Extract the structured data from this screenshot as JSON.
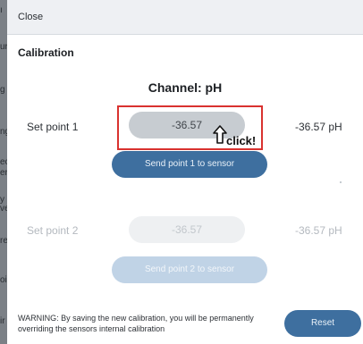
{
  "background": {
    "fragments": [
      "ı",
      "ur",
      "g",
      "ng",
      "ec",
      "er",
      "y",
      "ver",
      "re",
      "oir",
      "ir"
    ]
  },
  "header": {
    "close_label": "Close"
  },
  "calibration": {
    "title": "Calibration",
    "channel_title": "Channel: pH",
    "set_point_1": {
      "label": "Set point 1",
      "input_value": "-36.57",
      "display_value": "-36.57 pH",
      "send_label": "Send point 1 to sensor"
    },
    "set_point_2": {
      "label": "Set point 2",
      "input_value": "-36.57",
      "display_value": "-36.57 pH",
      "send_label": "Send point 2 to sensor"
    }
  },
  "annotation": {
    "click_label": "click!"
  },
  "footer": {
    "warning": "WARNING: By saving the new calibration, you will be permanently overriding the sensors internal calibration",
    "reset_label": "Reset"
  },
  "colors": {
    "accent": "#3e6f9f",
    "accent_disabled": "#c0d3e6",
    "highlight": "#d9322f"
  },
  "icons": {
    "cursor": "hand-pointer-icon"
  }
}
